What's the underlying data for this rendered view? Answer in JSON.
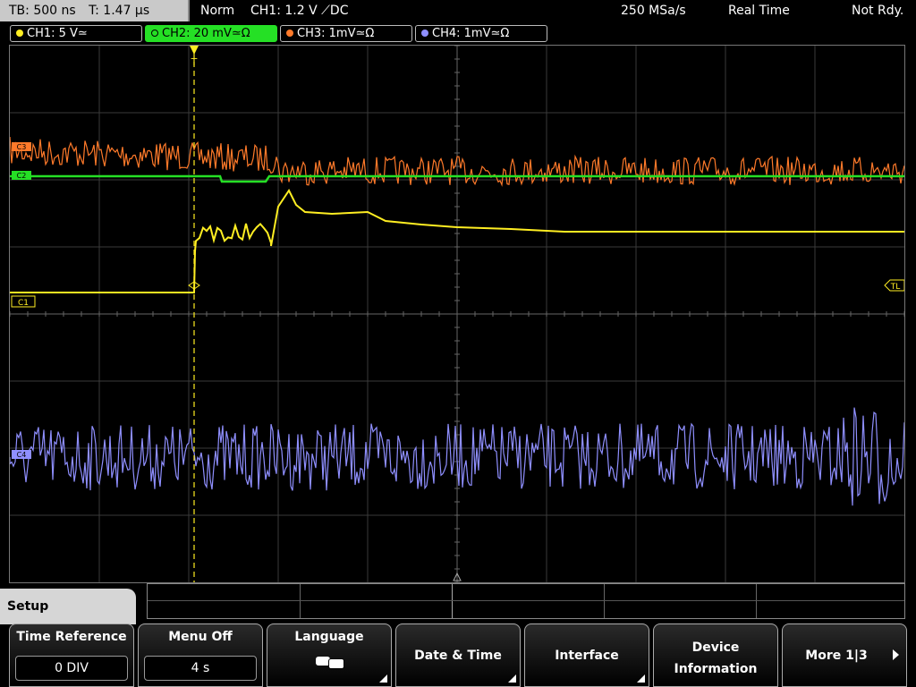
{
  "status": {
    "timebase": "TB: 500 ns",
    "trigger_time": "T: 1.47 µs",
    "trigger_mode": "Norm",
    "trigger_info": "CH1: 1.2 V ⟋DC",
    "sample_rate": "250 MSa/s",
    "acq_mode": "Real Time",
    "run_status": "Not Rdy."
  },
  "channels": [
    {
      "label": "CH1: 5 V≃",
      "color": "#ffee22"
    },
    {
      "label": "CH2: 20 mV≃Ω",
      "color": "#25e025"
    },
    {
      "label": "CH3: 1mV≃Ω",
      "color": "#ff7a2a"
    },
    {
      "label": "CH4: 1mV≃Ω",
      "color": "#8f8fff"
    }
  ],
  "markers": {
    "trigger_level": "TL",
    "ch1": "C1",
    "ch2": "C2",
    "ch3": "C3",
    "ch4": "C4",
    "trigger_pos": "T"
  },
  "menu": {
    "title": "Setup"
  },
  "softkeys": {
    "time_reference": {
      "label": "Time Reference",
      "value": "0 DIV"
    },
    "menu_off": {
      "label": "Menu Off",
      "value": "4 s"
    },
    "language": {
      "label": "Language",
      "icon": "speech-bubbles-icon"
    },
    "date_time": {
      "label": "Date & Time"
    },
    "interface": {
      "label": "Interface"
    },
    "device_information": {
      "line1": "Device",
      "line2": "Information"
    },
    "more": {
      "label": "More 1|3"
    }
  }
}
